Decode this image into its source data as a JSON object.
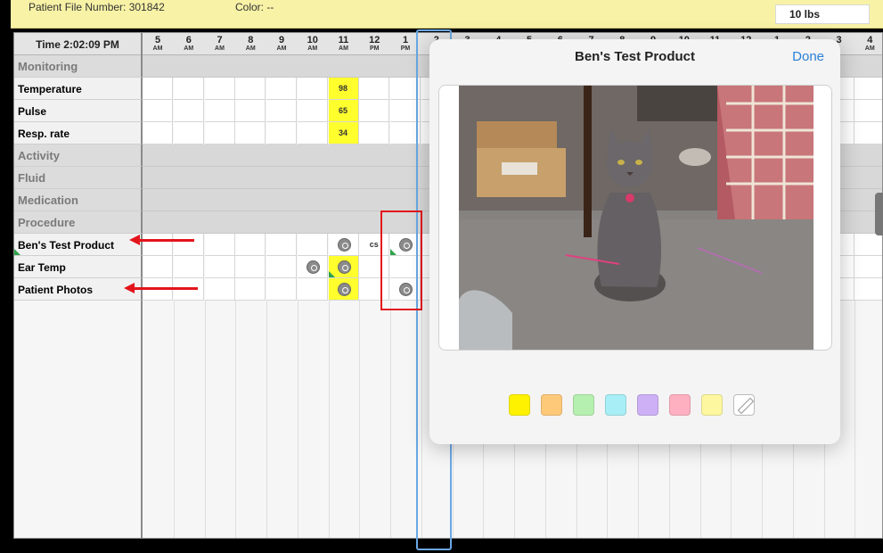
{
  "header": {
    "patient_file": "Patient File Number: 301842",
    "color": "Color: --",
    "weight": "10 lbs"
  },
  "chart": {
    "time_label": "Time 2:02:09 PM",
    "hours": [
      {
        "h": "5",
        "p": "AM"
      },
      {
        "h": "6",
        "p": "AM"
      },
      {
        "h": "7",
        "p": "AM"
      },
      {
        "h": "8",
        "p": "AM"
      },
      {
        "h": "9",
        "p": "AM"
      },
      {
        "h": "10",
        "p": "AM"
      },
      {
        "h": "11",
        "p": "AM"
      },
      {
        "h": "12",
        "p": "PM"
      },
      {
        "h": "1",
        "p": "PM"
      },
      {
        "h": "2",
        "p": ""
      },
      {
        "h": "3",
        "p": ""
      },
      {
        "h": "4",
        "p": ""
      },
      {
        "h": "5",
        "p": ""
      },
      {
        "h": "6",
        "p": ""
      },
      {
        "h": "7",
        "p": ""
      },
      {
        "h": "8",
        "p": ""
      },
      {
        "h": "9",
        "p": ""
      },
      {
        "h": "10",
        "p": ""
      },
      {
        "h": "11",
        "p": ""
      },
      {
        "h": "12",
        "p": ""
      },
      {
        "h": "1",
        "p": ""
      },
      {
        "h": "2",
        "p": ""
      },
      {
        "h": "3",
        "p": ""
      },
      {
        "h": "4",
        "p": "AM"
      }
    ],
    "rows": [
      {
        "label": "Monitoring",
        "type": "section"
      },
      {
        "label": "Temperature",
        "type": "data",
        "cells": {
          "6": {
            "v": "98",
            "yellow": true
          }
        }
      },
      {
        "label": "Pulse",
        "type": "data",
        "cells": {
          "6": {
            "v": "65",
            "yellow": true
          }
        }
      },
      {
        "label": "Resp. rate",
        "type": "data",
        "cells": {
          "6": {
            "v": "34",
            "yellow": true
          }
        }
      },
      {
        "label": "Activity",
        "type": "section"
      },
      {
        "label": "Fluid",
        "type": "section"
      },
      {
        "label": "Medication",
        "type": "section"
      },
      {
        "label": "Procedure",
        "type": "section"
      },
      {
        "label": "Ben's Test Product",
        "type": "data",
        "tri": true,
        "cells": {
          "6": {
            "cam": true
          },
          "7": {
            "v": "cs"
          },
          "8": {
            "cam": true,
            "tri": true
          }
        }
      },
      {
        "label": "Ear Temp",
        "type": "data",
        "cells": {
          "5": {
            "cam": true
          },
          "6": {
            "cam": true,
            "yellow": true,
            "tri": true
          }
        }
      },
      {
        "label": "Patient Photos",
        "type": "data",
        "cells": {
          "6": {
            "cam": true,
            "yellow": true
          },
          "8": {
            "cam": true
          }
        }
      }
    ]
  },
  "popover": {
    "title": "Ben's Test Product",
    "done_label": "Done",
    "swatches": [
      "#fff200",
      "#ffc97a",
      "#b6f0b0",
      "#a8eef7",
      "#cdb0f5",
      "#ffb0c0",
      "#fdf7a0"
    ],
    "pencil_icon": "pencil-icon"
  }
}
